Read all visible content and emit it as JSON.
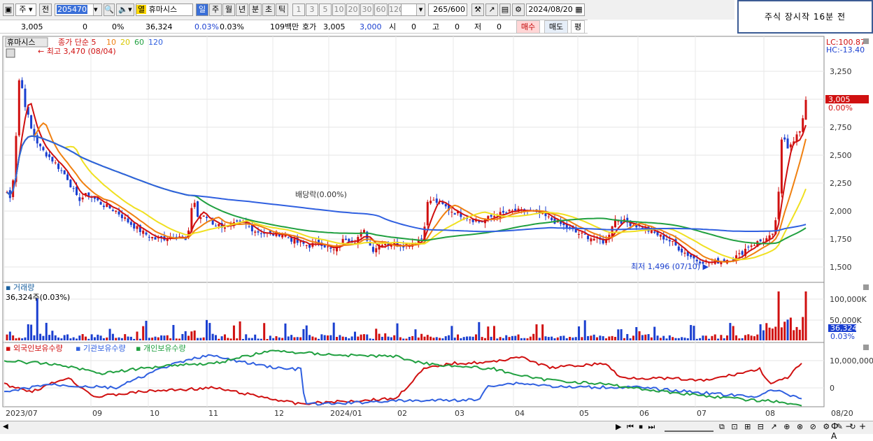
{
  "toolbar": {
    "period_select": "주",
    "prev_label": "전",
    "code": "205470",
    "market_flag": "열",
    "stock_name": "휴마시스",
    "periods": [
      "일",
      "주",
      "월",
      "년",
      "분",
      "초",
      "틱"
    ],
    "active_period": "일",
    "intervals": [
      "1",
      "3",
      "5",
      "10",
      "20",
      "30",
      "60",
      "120"
    ],
    "count": "265",
    "count_max": "/600",
    "date": "2024/08/20"
  },
  "notice": "주식 장시작 16분 전",
  "info_row": {
    "price": "3,005",
    "change": "0",
    "change_pct": "0%",
    "volume": "36,324",
    "vol_pct1": "0.03%",
    "vol_pct2": "0.03%",
    "amount": "109백만",
    "bid_label": "호가",
    "bid_value": "3,005",
    "ask_value": "3,000",
    "open_label": "시",
    "open_value": "0",
    "high_label": "고",
    "high_value": "0",
    "low_label": "저",
    "low_value": "0",
    "buy": "매수",
    "sell": "매도",
    "eval": "평"
  },
  "price_panel": {
    "legend_name": "휴마시스",
    "legend_ma_label": "종가 단순 5",
    "ma_periods": [
      "10",
      "20",
      "60",
      "120"
    ],
    "max_annotation": "최고 3,470 (08/04)",
    "min_annotation": "최저 1,496 (07/10)",
    "dividend_annotation": "배당락(0.00%)",
    "lc_label": "LC:100.87",
    "hc_label": "HC:-13.40",
    "current_price": "3,005",
    "current_pct": "0.00%",
    "y_ticks": [
      "3,250",
      "3,000",
      "2,750",
      "2,500",
      "2,250",
      "2,000",
      "1,750",
      "1,500"
    ]
  },
  "volume_panel": {
    "title": "거래량",
    "value_label": "36,324주(0.03%)",
    "y_ticks": [
      "100,000K",
      "50,000K"
    ],
    "current": "36,324",
    "current_pct": "0.03%"
  },
  "holder_panel": {
    "labels": [
      "외국인보유수량",
      "기관보유수량",
      "개인보유수량"
    ],
    "y_ticks": [
      "10,000,000",
      "0"
    ]
  },
  "x_axis": [
    "2023/07",
    "09",
    "10",
    "11",
    "12",
    "2024/01",
    "02",
    "03",
    "04",
    "05",
    "06",
    "07",
    "08",
    "08/20"
  ],
  "colors": {
    "up": "#d01010",
    "down": "#1a3fd0",
    "ma5": "#d01010",
    "ma10": "#f08010",
    "ma20": "#f0e020",
    "ma60": "#20a040",
    "ma120": "#3060e0"
  }
}
